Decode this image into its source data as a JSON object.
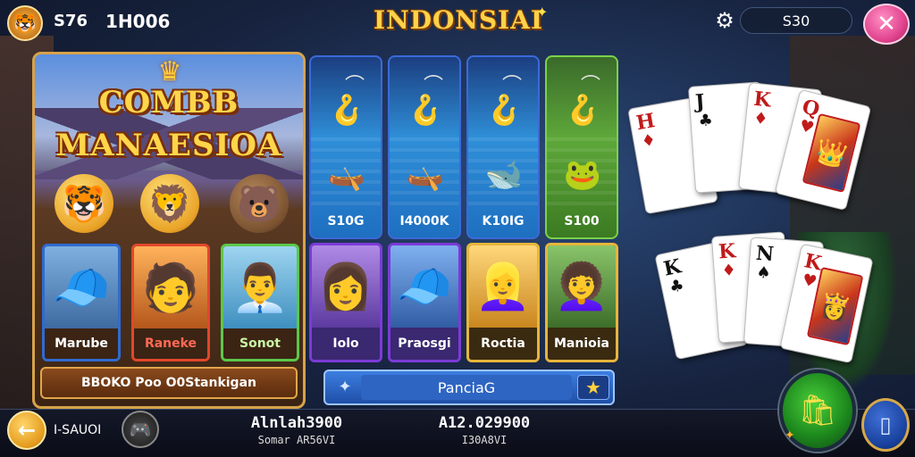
{
  "topbar": {
    "level": "S76",
    "coins": "1H006",
    "title": "INDONSIAI",
    "pill_value": "S30"
  },
  "left_panel": {
    "logo_line1": "COMBB",
    "logo_line2": "MANAESIOA",
    "players": [
      {
        "name": "Marube"
      },
      {
        "name": "Raneke"
      },
      {
        "name": "Sonot"
      }
    ],
    "banner": "BBOKO Poo O0Stankigan"
  },
  "fish_cards": [
    {
      "value": "S10G"
    },
    {
      "value": "I4000K"
    },
    {
      "value": "K10IG"
    },
    {
      "value": "S100"
    }
  ],
  "mid_players": [
    {
      "name": "Iolo"
    },
    {
      "name": "Praosgi"
    },
    {
      "name": "Roctia"
    },
    {
      "name": "Manioia"
    }
  ],
  "search": {
    "value": "PanciaG"
  },
  "cards": [
    {
      "rank": "H",
      "suit": "♦",
      "red": true
    },
    {
      "rank": "J",
      "suit": "♣",
      "red": false
    },
    {
      "rank": "K",
      "suit": "♦",
      "red": true
    },
    {
      "rank": "Q",
      "suit": "♥",
      "red": true
    },
    {
      "rank": "K",
      "suit": "♣",
      "red": false
    },
    {
      "rank": "K",
      "suit": "♦",
      "red": true
    },
    {
      "rank": "N",
      "suit": "♠",
      "red": false
    },
    {
      "rank": "K",
      "suit": "♥",
      "red": true
    }
  ],
  "bottombar": {
    "label": "I-SAUOI",
    "stat1_value": "Alnlah3900",
    "stat1_sub": "Somar AR56VI",
    "stat2_value": "A12.029900",
    "stat2_sub": "I30A8VI"
  },
  "icons": {
    "emblem": "tiger-emblem-icon",
    "settings": "gear-icon",
    "close": "close-icon",
    "back": "back-arrow-icon",
    "shop": "shop-bag-icon",
    "menu": "phone-menu-icon",
    "search": "sparkle-icon",
    "favorite": "star-icon"
  },
  "colors": {
    "title_gold": "#ffd24a",
    "close_pink": "#e2458f",
    "panel_border": "#d7a24a",
    "fish_blue": "#2f8fd8",
    "fish_green": "#5ea83a",
    "shop_green": "#1e8a1e"
  }
}
